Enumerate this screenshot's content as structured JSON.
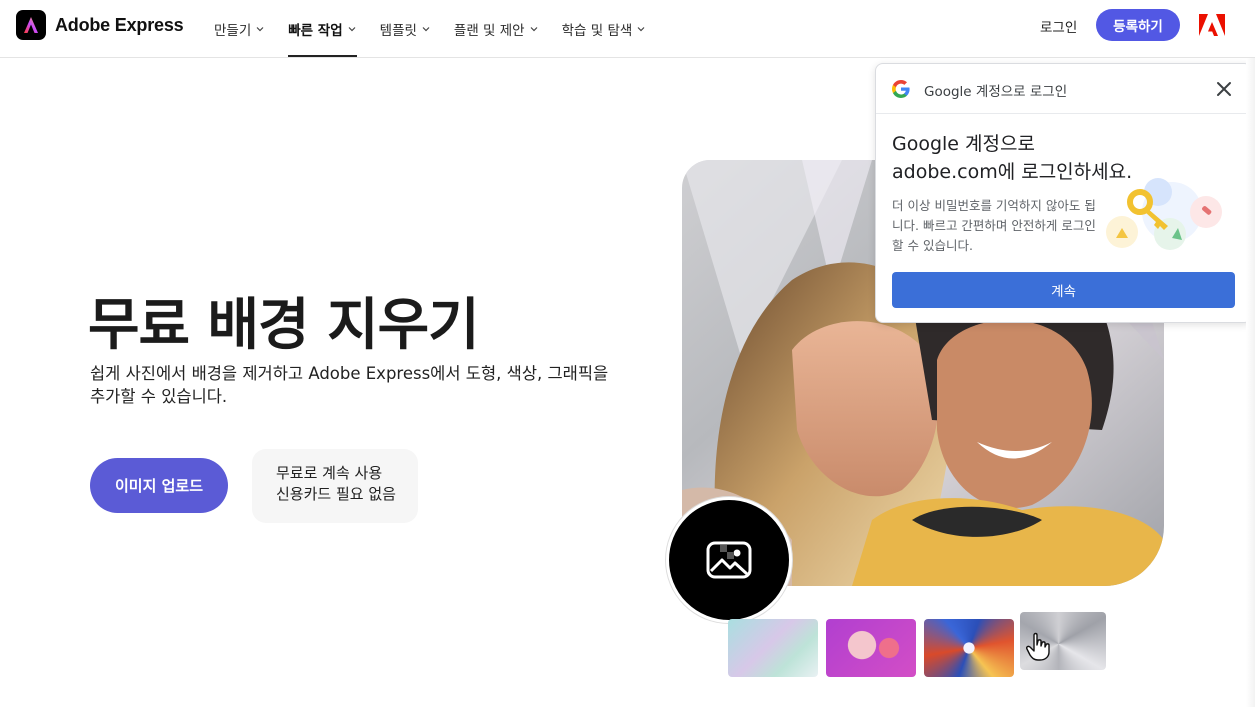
{
  "header": {
    "brand": "Adobe Express",
    "nav": [
      {
        "label": "만들기",
        "active": false
      },
      {
        "label": "빠른 작업",
        "active": true
      },
      {
        "label": "템플릿",
        "active": false
      },
      {
        "label": "플랜 및 제안",
        "active": false
      },
      {
        "label": "학습 및 탐색",
        "active": false
      }
    ],
    "login": "로그인",
    "signup": "등록하기"
  },
  "hero": {
    "title": "무료 배경 지우기",
    "subtitle": "쉽게 사진에서 배경을 제거하고 Adobe Express에서 도형, 색상, 그래픽을 추가할 수 있습니다.",
    "upload_button": "이미지 업로드",
    "free_line1": "무료로 계속 사용",
    "free_line2": "신용카드 필요 없음"
  },
  "google_popup": {
    "header_text": "Google 계정으로 로그인",
    "title_line1": "Google 계정으로",
    "title_line2": "adobe.com에 로그인하세요.",
    "description": "더 이상 비밀번호를 기억하지 않아도 됩니다. 빠르고 간편하며 안전하게 로그인할 수 있습니다.",
    "continue_button": "계속"
  },
  "colors": {
    "accent": "#5258e4",
    "upload": "#5b5bd6",
    "google_button": "#3b6fd8"
  },
  "icons": [
    "adobe-express-logo-icon",
    "chevron-down-icon",
    "adobe-logo-icon",
    "google-g-icon",
    "close-icon",
    "image-icon",
    "key-icon",
    "hand-cursor-icon"
  ]
}
